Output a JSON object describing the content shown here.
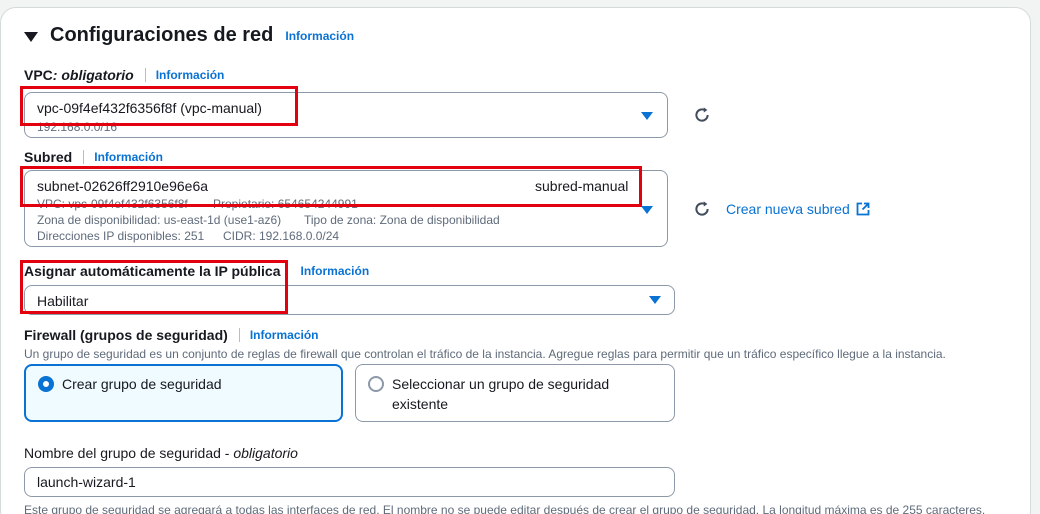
{
  "section": {
    "title": "Configuraciones de red",
    "info": "Información"
  },
  "vpc": {
    "label": "VPC",
    "required": " : obligatorio",
    "info": "Información",
    "value": "vpc-09f4ef432f6356f8f (vpc-manual)",
    "cidr": "192.168.0.0/16"
  },
  "subnet": {
    "label": "Subred",
    "info": "Información",
    "id": "subnet-02626ff2910e96e6a",
    "name": "subred-manual",
    "vpc_line": "VPC: vpc-09f4ef432f6356f8f",
    "owner_line": "Propietario: 654654244991",
    "az": "Zona de disponibilidad: us-east-1d (use1-az6)",
    "zone_type": "Tipo de zona: Zona de disponibilidad",
    "ips": "Direcciones IP disponibles: 251",
    "cidr": "CIDR: 192.168.0.0/24",
    "create_link": "Crear nueva subred"
  },
  "public_ip": {
    "label": "Asignar automáticamente la IP pública",
    "info": "Información",
    "value": "Habilitar"
  },
  "firewall": {
    "label": "Firewall (grupos de seguridad)",
    "info": "Información",
    "description": "Un grupo de seguridad es un conjunto de reglas de firewall que controlan el tráfico de la instancia. Agregue reglas para permitir que un tráfico específico llegue a la instancia.",
    "option_create": "Crear grupo de seguridad",
    "option_select_line1": "Seleccionar un grupo de seguridad",
    "option_select_line2": "existente"
  },
  "sg_name": {
    "label": "Nombre del grupo de seguridad - ",
    "required": "obligatorio",
    "value": "launch-wizard-1",
    "help": "Este grupo de seguridad se agregará a todas las interfaces de red. El nombre no se puede editar después de crear el grupo de seguridad. La longitud máxima es de 255 caracteres."
  },
  "icons": {
    "refresh": "refresh-icon",
    "external": "external-link-icon",
    "expand": "caret-down-icon"
  },
  "colors": {
    "link": "#0972d3",
    "highlight": "#e3000f",
    "text": "#16191f",
    "muted": "#5f6b7a"
  }
}
